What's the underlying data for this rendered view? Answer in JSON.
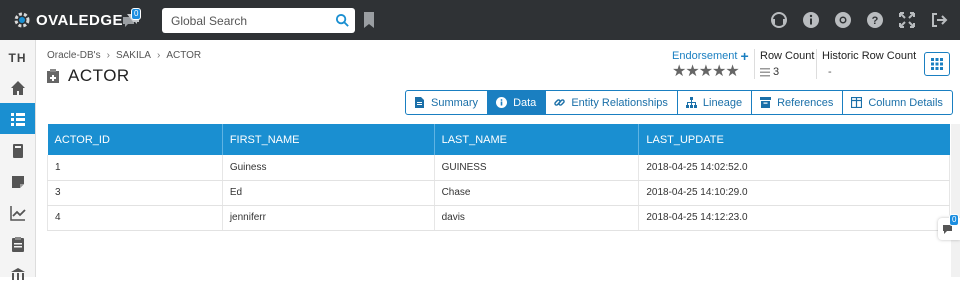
{
  "brand": {
    "name": "OVALEDGE"
  },
  "header": {
    "chat_badge": "0",
    "search_placeholder": "Global Search"
  },
  "sidebar": {
    "initials": "TH",
    "items": [
      "home",
      "catalog",
      "book",
      "notes",
      "chart",
      "clipboard",
      "bank"
    ]
  },
  "breadcrumb": [
    "Oracle-DB's",
    "SAKILA",
    "ACTOR"
  ],
  "page": {
    "title": "ACTOR"
  },
  "endorsement": {
    "label": "Endorsement",
    "plus": "+",
    "stars": "★★★★★"
  },
  "row_count": {
    "label": "Row Count",
    "value": "3"
  },
  "historic_row_count": {
    "label": "Historic Row Count",
    "value": "-"
  },
  "tabs": [
    {
      "label": "Summary",
      "icon": "file-icon"
    },
    {
      "label": "Data",
      "icon": "info-icon"
    },
    {
      "label": "Entity Relationships",
      "icon": "link-icon"
    },
    {
      "label": "Lineage",
      "icon": "sitemap-icon"
    },
    {
      "label": "References",
      "icon": "inbox-icon"
    },
    {
      "label": "Column Details",
      "icon": "columns-icon"
    }
  ],
  "active_tab": "Data",
  "table": {
    "columns": [
      "ACTOR_ID",
      "FIRST_NAME",
      "LAST_NAME",
      "LAST_UPDATE"
    ],
    "rows": [
      [
        "1",
        "Guiness",
        "GUINESS",
        "2018-04-25 14:02:52.0"
      ],
      [
        "3",
        "Ed",
        "Chase",
        "2018-04-25 14:10:29.0"
      ],
      [
        "4",
        "jenniferr",
        "davis",
        "2018-04-25 14:12:23.0"
      ]
    ]
  },
  "floating_chat_badge": "0",
  "colors": {
    "topbar": "#2f3235",
    "accent": "#1a8fd1",
    "link": "#1a7fc1"
  }
}
